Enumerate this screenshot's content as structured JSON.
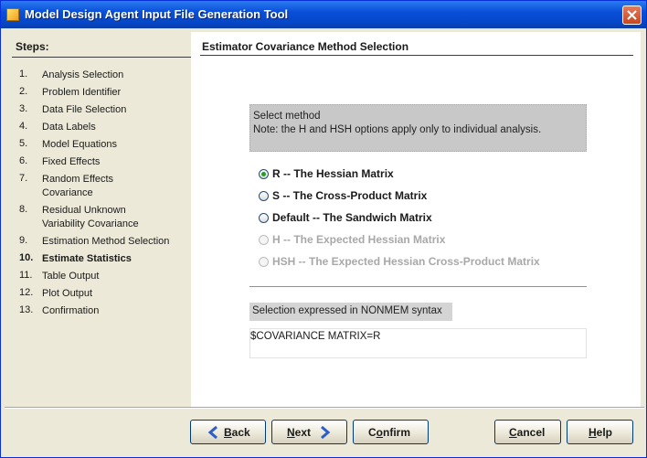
{
  "window": {
    "title": "Model Design Agent Input File Generation Tool"
  },
  "steps": {
    "heading": "Steps:",
    "items": [
      {
        "num": "1.",
        "label": "Analysis Selection"
      },
      {
        "num": "2.",
        "label": "Problem Identifier"
      },
      {
        "num": "3.",
        "label": "Data File Selection"
      },
      {
        "num": "4.",
        "label": "Data Labels"
      },
      {
        "num": "5.",
        "label": "Model Equations"
      },
      {
        "num": "6.",
        "label": "Fixed Effects"
      },
      {
        "num": "7.",
        "label": "Random Effects Covariance"
      },
      {
        "num": "8.",
        "label": "Residual Unknown Variability Covariance"
      },
      {
        "num": "9.",
        "label": "Estimation Method Selection"
      },
      {
        "num": "10.",
        "label": "Estimate Statistics"
      },
      {
        "num": "11.",
        "label": "Table Output"
      },
      {
        "num": "12.",
        "label": "Plot Output"
      },
      {
        "num": "13.",
        "label": "Confirmation"
      }
    ],
    "active_index": 9
  },
  "main": {
    "section_title": "Estimator Covariance Method Selection",
    "method_box": {
      "line1": "Select method",
      "line2": "Note: the H and HSH options apply only to individual analysis."
    },
    "options": [
      {
        "label": "R -- The Hessian Matrix",
        "checked": true,
        "enabled": true
      },
      {
        "label": "S -- The Cross-Product Matrix",
        "checked": false,
        "enabled": true
      },
      {
        "label": "Default -- The Sandwich Matrix",
        "checked": false,
        "enabled": true
      },
      {
        "label": "H -- The Expected Hessian Matrix",
        "checked": false,
        "enabled": false
      },
      {
        "label": "HSH -- The Expected Hessian Cross-Product Matrix",
        "checked": false,
        "enabled": false
      }
    ],
    "syntax_label": "Selection expressed in NONMEM syntax",
    "syntax_value": "$COVARIANCE MATRIX=R"
  },
  "buttons": {
    "back": {
      "mnemonic": "B",
      "rest": "ack"
    },
    "next": {
      "mnemonic": "N",
      "rest": "ext"
    },
    "confirm": {
      "pre": "C",
      "mnemonic": "o",
      "rest": "nfirm"
    },
    "cancel": {
      "mnemonic": "C",
      "rest": "ancel"
    },
    "help": {
      "mnemonic": "H",
      "rest": "elp"
    }
  },
  "colors": {
    "title_bar": "#0a4fd9",
    "accent_radio": "#2a9a2a",
    "arrow_blue": "#2e5cc8"
  },
  "icons": {
    "back": "arrow-left-icon",
    "next": "arrow-right-icon",
    "close": "close-icon"
  }
}
